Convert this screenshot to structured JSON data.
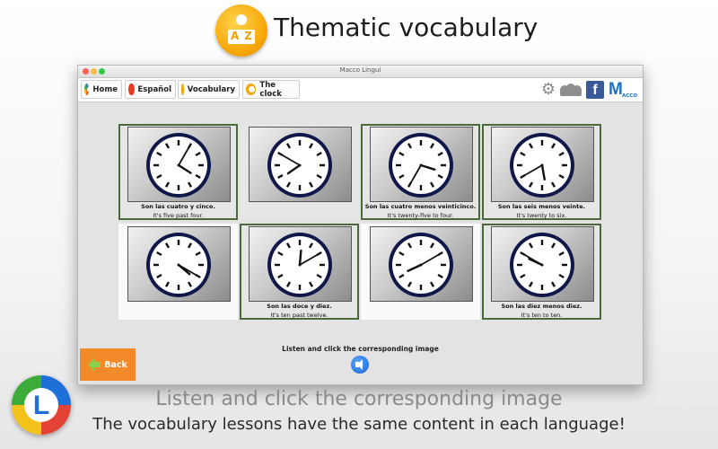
{
  "promo": {
    "title": "Thematic vocabulary",
    "badge": {
      "left": "A",
      "right": "Z"
    },
    "line1": "Listen and click the corresponding image",
    "line2": "The vocabulary lessons have the same content in each language!",
    "corner_logo_letter": "L"
  },
  "window": {
    "title": "Macco Lingui",
    "tabs": [
      {
        "label": "Home",
        "icon": "home-logo-icon"
      },
      {
        "label": "Español",
        "icon": "spanish-flag-icon"
      },
      {
        "label": "Vocabulary",
        "icon": "vocabulary-icon"
      },
      {
        "label": "The clock",
        "icon": "clock-icon"
      }
    ],
    "toolbar_icons": [
      "gear-icon",
      "users-icon",
      "facebook-icon",
      "macco-logo-icon"
    ],
    "facebook_letter": "f",
    "macco": {
      "letter": "M",
      "text": "ACCO"
    }
  },
  "clocks": [
    {
      "spanish": "Son las cuatro y cinco.",
      "english": "It's five past four.",
      "hour": 4,
      "minute": 5,
      "bordered": true,
      "white": false
    },
    {
      "spanish": "",
      "english": "",
      "hour": 7,
      "minute": 50,
      "bordered": false,
      "white": false
    },
    {
      "spanish": "Son las cuatro menos veinticinco.",
      "english": "It's twenty-five to four.",
      "hour": 3,
      "minute": 35,
      "bordered": true,
      "white": false
    },
    {
      "spanish": "Son las seis menos veinte.",
      "english": "It's twenty to six.",
      "hour": 5,
      "minute": 40,
      "bordered": true,
      "white": false
    },
    {
      "spanish": "",
      "english": "",
      "hour": 4,
      "minute": 20,
      "bordered": false,
      "white": true
    },
    {
      "spanish": "Son las doce y diez.",
      "english": "It's ten past twelve.",
      "hour": 12,
      "minute": 10,
      "bordered": true,
      "white": false
    },
    {
      "spanish": "",
      "english": "",
      "hour": 8,
      "minute": 10,
      "bordered": false,
      "white": true
    },
    {
      "spanish": "Son las diez menos diez.",
      "english": "It's ten to ten.",
      "hour": 9,
      "minute": 50,
      "bordered": true,
      "white": false
    }
  ],
  "instruction": "Listen and click the corresponding image",
  "back_label": "Back",
  "colors": {
    "back_button": "#f28a2a",
    "card_border": "#4b6a3a",
    "clock_rim": "#10184a"
  }
}
